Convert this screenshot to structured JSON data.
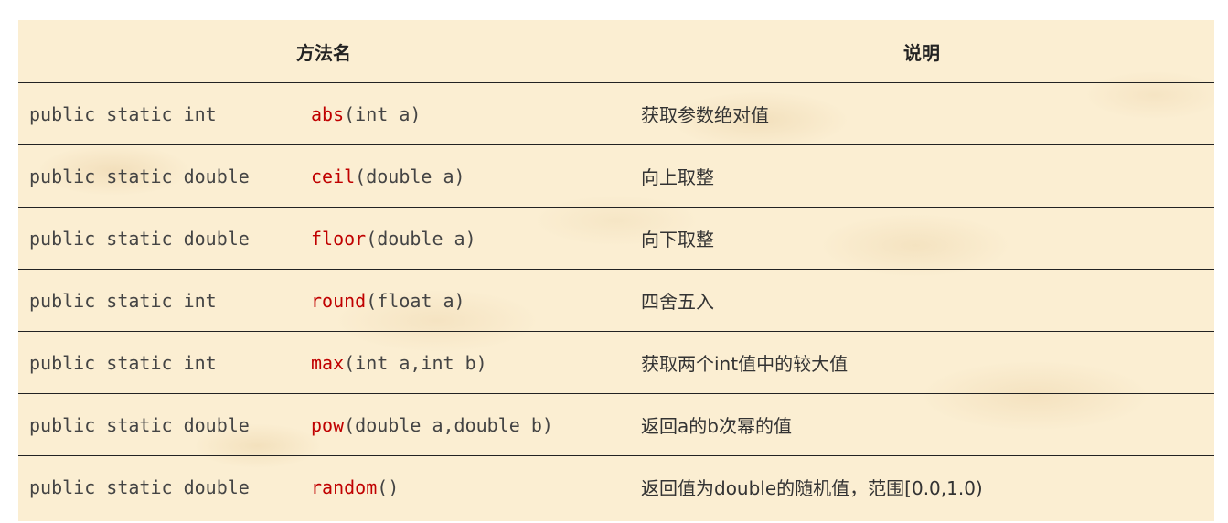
{
  "table": {
    "headers": {
      "method": "方法名",
      "description": "说明"
    },
    "rows": [
      {
        "prefix": "public static int",
        "name": "abs",
        "params": "(int a)",
        "desc": "获取参数绝对值"
      },
      {
        "prefix": "public static double",
        "name": "ceil",
        "params": "(double a)",
        "desc": "向上取整"
      },
      {
        "prefix": "public static double",
        "name": "floor",
        "params": "(double a)",
        "desc": "向下取整"
      },
      {
        "prefix": "public static int",
        "name": "round",
        "params": "(float a)",
        "desc": "四舍五入"
      },
      {
        "prefix": "public static int",
        "name": "max",
        "params": "(int a,int b)",
        "desc": "获取两个int值中的较大值"
      },
      {
        "prefix": "public static double",
        "name": "pow",
        "params": "(double a,double b)",
        "desc": "返回a的b次幂的值"
      },
      {
        "prefix": "public static double",
        "name": "random",
        "params": "()",
        "desc": "返回值为double的随机值，范围[0.0,1.0)"
      }
    ]
  },
  "colors": {
    "method_name": "#c00000",
    "background": "#fbeed2",
    "rule": "#222222"
  }
}
